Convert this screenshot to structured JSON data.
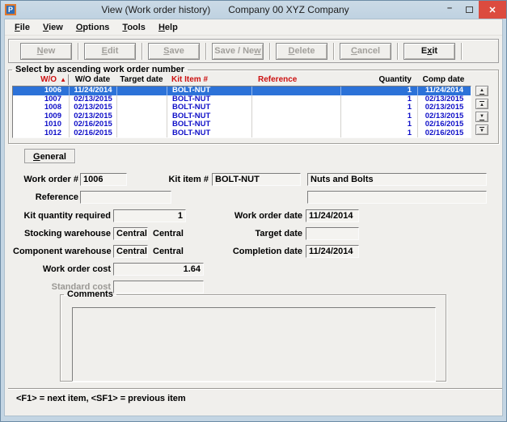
{
  "window": {
    "icon_letter": "P",
    "title_primary": "View (Work order history)",
    "title_secondary": "Company 00  XYZ Company",
    "controls": {
      "minimize": "–",
      "close": "✕"
    }
  },
  "colors": {
    "selection_blue": "#2c72d8",
    "grid_text_blue": "#0f0fc8",
    "header_red": "#cc1111",
    "close_button_red": "#dc4b3f",
    "frame_blue": "#c3d5e3"
  },
  "menu": {
    "items": [
      {
        "pre": "",
        "key": "F",
        "post": "ile"
      },
      {
        "pre": "",
        "key": "V",
        "post": "iew"
      },
      {
        "pre": "",
        "key": "O",
        "post": "ptions"
      },
      {
        "pre": "",
        "key": "T",
        "post": "ools"
      },
      {
        "pre": "",
        "key": "H",
        "post": "elp"
      }
    ]
  },
  "toolbar": {
    "buttons": [
      {
        "pre": "",
        "key": "N",
        "post": "ew",
        "state": "disabled"
      },
      {
        "pre": "",
        "key": "E",
        "post": "dit",
        "state": "disabled"
      },
      {
        "pre": "",
        "key": "S",
        "post": "ave",
        "state": "disabled"
      },
      {
        "pre": "Save / Ne",
        "key": "w",
        "post": "",
        "state": "disabled"
      },
      {
        "pre": "",
        "key": "D",
        "post": "elete",
        "state": "disabled"
      },
      {
        "pre": "",
        "key": "C",
        "post": "ancel",
        "state": "disabled"
      },
      {
        "pre": "E",
        "key": "x",
        "post": "it",
        "state": "enabled"
      }
    ]
  },
  "grid": {
    "legend": "Select by ascending work order number",
    "sort_icon": "▲",
    "header": {
      "wo": "W/O",
      "wo_date": "W/O date",
      "target": "Target date",
      "kit": "Kit Item #",
      "reference": "Reference",
      "quantity": "Quantity",
      "comp": "Comp date"
    },
    "rows": [
      {
        "wo": "1006",
        "wo_date": "11/24/2014",
        "target": "",
        "kit": "BOLT-NUT",
        "reference": "",
        "quantity": "1",
        "comp": "11/24/2014"
      },
      {
        "wo": "1007",
        "wo_date": "02/13/2015",
        "target": "",
        "kit": "BOLT-NUT",
        "reference": "",
        "quantity": "1",
        "comp": "02/13/2015"
      },
      {
        "wo": "1008",
        "wo_date": "02/13/2015",
        "target": "",
        "kit": "BOLT-NUT",
        "reference": "",
        "quantity": "1",
        "comp": "02/13/2015"
      },
      {
        "wo": "1009",
        "wo_date": "02/13/2015",
        "target": "",
        "kit": "BOLT-NUT",
        "reference": "",
        "quantity": "1",
        "comp": "02/13/2015"
      },
      {
        "wo": "1010",
        "wo_date": "02/16/2015",
        "target": "",
        "kit": "BOLT-NUT",
        "reference": "",
        "quantity": "1",
        "comp": "02/16/2015"
      },
      {
        "wo": "1012",
        "wo_date": "02/16/2015",
        "target": "",
        "kit": "BOLT-NUT",
        "reference": "",
        "quantity": "1",
        "comp": "02/16/2015"
      }
    ],
    "nav_icons": {
      "row_up": "▲",
      "page_up": "▲",
      "page_down": "▼",
      "row_down": "▼"
    }
  },
  "tab": {
    "pre": "",
    "key": "G",
    "post": "eneral"
  },
  "form": {
    "work_order_label": "Work order #",
    "work_order_value": "1006",
    "kit_item_label": "Kit item #",
    "kit_item_value": "BOLT-NUT",
    "kit_item_desc": "Nuts and Bolts",
    "reference_label": "Reference",
    "reference_value": "",
    "reference_desc": "",
    "kit_qty_label": "Kit quantity required",
    "kit_qty_value": "1",
    "work_order_date_label": "Work order date",
    "work_order_date_value": "11/24/2014",
    "stocking_wh_label": "Stocking warehouse",
    "stocking_wh_value": "Central",
    "stocking_wh_desc": "Central",
    "target_date_label": "Target date",
    "target_date_value": "",
    "component_wh_label": "Component warehouse",
    "component_wh_value": "Central",
    "component_wh_desc": "Central",
    "completion_date_label": "Completion date",
    "completion_date_value": "11/24/2014",
    "wo_cost_label": "Work order cost",
    "wo_cost_value": "1.64",
    "std_cost_label": "Standard cost",
    "std_cost_value": ""
  },
  "comments": {
    "legend": "Comments",
    "value": ""
  },
  "status": {
    "hint": "<F1> = next item, <SF1> = previous item"
  }
}
